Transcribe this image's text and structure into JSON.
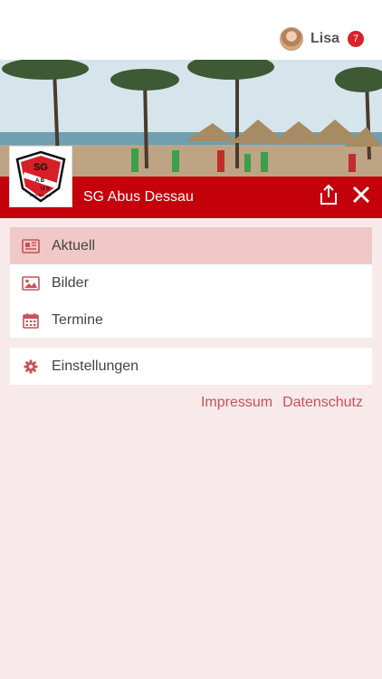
{
  "user": {
    "name": "Lisa",
    "notification_count": "7"
  },
  "club": {
    "name": "SG Abus Dessau",
    "logo_text": "SG ABUS",
    "logo_subtext": "DESSAU e.V."
  },
  "menu": {
    "items": [
      {
        "label": "Aktuell",
        "icon": "newspaper-icon",
        "active": true
      },
      {
        "label": "Bilder",
        "icon": "image-icon",
        "active": false
      },
      {
        "label": "Termine",
        "icon": "calendar-icon",
        "active": false
      }
    ],
    "settings_label": "Einstellungen"
  },
  "footer_links": {
    "impressum": "Impressum",
    "datenschutz": "Datenschutz"
  },
  "colors": {
    "brand_red": "#c4000b",
    "active_bg": "#f0c8c8",
    "page_bg": "#f8eaea",
    "link": "#c9505a"
  }
}
